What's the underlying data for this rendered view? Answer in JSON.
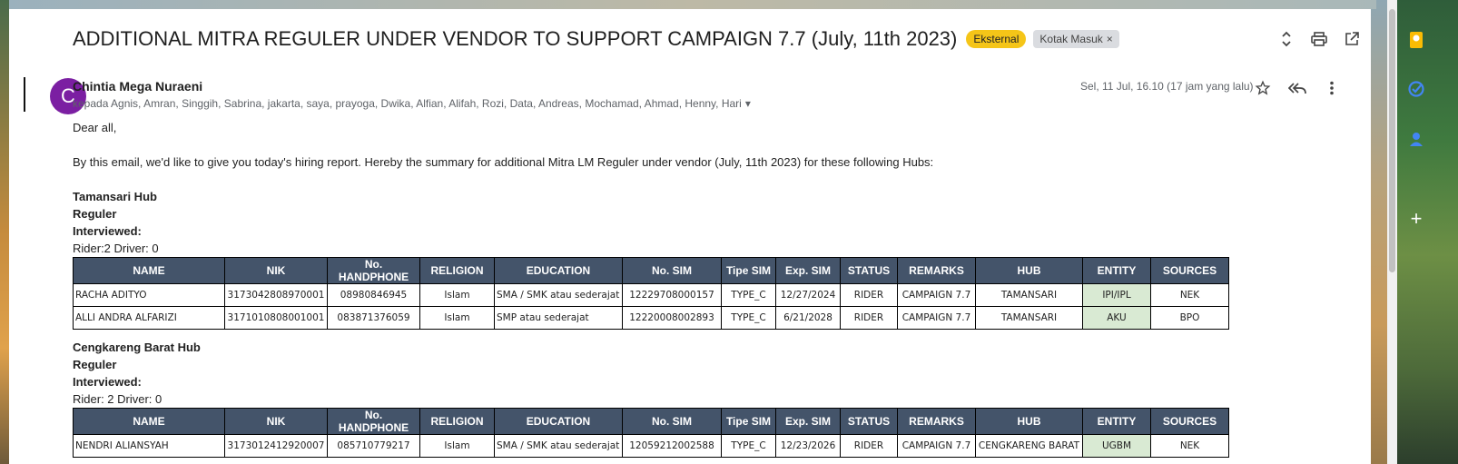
{
  "email": {
    "subject": "ADDITIONAL MITRA REGULER UNDER VENDOR TO SUPPORT CAMPAIGN 7.7 (July, 11th 2023)",
    "label_external": "Eksternal",
    "label_inbox": "Kotak Masuk",
    "label_inbox_close": "×",
    "avatar_letter": "C",
    "sender": "Chintia Mega Nuraeni",
    "recipients": "kepada Agnis, Amran, Singgih, Sabrina, jakarta, saya, prayoga, Dwika, Alfian, Alifah, Rozi, Data, Andreas, Mochamad, Ahmad, Henny, Hari",
    "datetime": "Sel, 11 Jul, 16.10 (17 jam yang lalu)"
  },
  "icons": {
    "expand": "unfold-icon",
    "print": "print-icon",
    "open_new": "open-in-new-icon",
    "star": "star-icon",
    "reply_all": "reply-all-icon",
    "more": "more-vert-icon"
  },
  "body": {
    "greeting": "Dear all,",
    "intro": "By this email, we'd like to give you today's hiring report. Hereby the summary for additional Mitra LM Reguler under vendor (July, 11th 2023) for these following Hubs:"
  },
  "table_headers": [
    "NAME",
    "NIK",
    "No. HANDPHONE",
    "RELIGION",
    "EDUCATION",
    "No. SIM",
    "Tipe SIM",
    "Exp. SIM",
    "STATUS",
    "REMARKS",
    "HUB",
    "ENTITY",
    "SOURCES"
  ],
  "hubs": [
    {
      "title": "Tamansari Hub",
      "type": "Reguler",
      "interviewed": "Interviewed:",
      "counts": "Rider:2 Driver: 0",
      "rows": [
        [
          "RACHA ADITYO",
          "3173042808970001",
          "08980846945",
          "Islam",
          "SMA / SMK atau sederajat",
          "12229708000157",
          "TYPE_C",
          "12/27/2024",
          "RIDER",
          "CAMPAIGN 7.7",
          "TAMANSARI",
          "IPI/IPL",
          "NEK"
        ],
        [
          "ALLI ANDRA ALFARIZI",
          "3171010808001001",
          "083871376059",
          "Islam",
          "SMP atau sederajat",
          "12220008002893",
          "TYPE_C",
          "6/21/2028",
          "RIDER",
          "CAMPAIGN 7.7",
          "TAMANSARI",
          "AKU",
          "BPO"
        ]
      ]
    },
    {
      "title": "Cengkareng Barat Hub",
      "type": "Reguler",
      "interviewed": "Interviewed:",
      "counts": "Rider: 2 Driver: 0",
      "rows": [
        [
          "NENDRI ALIANSYAH",
          "3173012412920007",
          "085710779217",
          "Islam",
          "SMA / SMK atau sederajat",
          "12059212002588",
          "TYPE_C",
          "12/23/2026",
          "RIDER",
          "CAMPAIGN 7.7",
          "CENGKARENG BARAT",
          "UGBM",
          "NEK"
        ]
      ]
    }
  ],
  "colors": {
    "header_bg": "#44546a",
    "entity_bg": "#d9ead3",
    "chip_external": "#f5c518",
    "avatar": "#7b1fa2"
  }
}
